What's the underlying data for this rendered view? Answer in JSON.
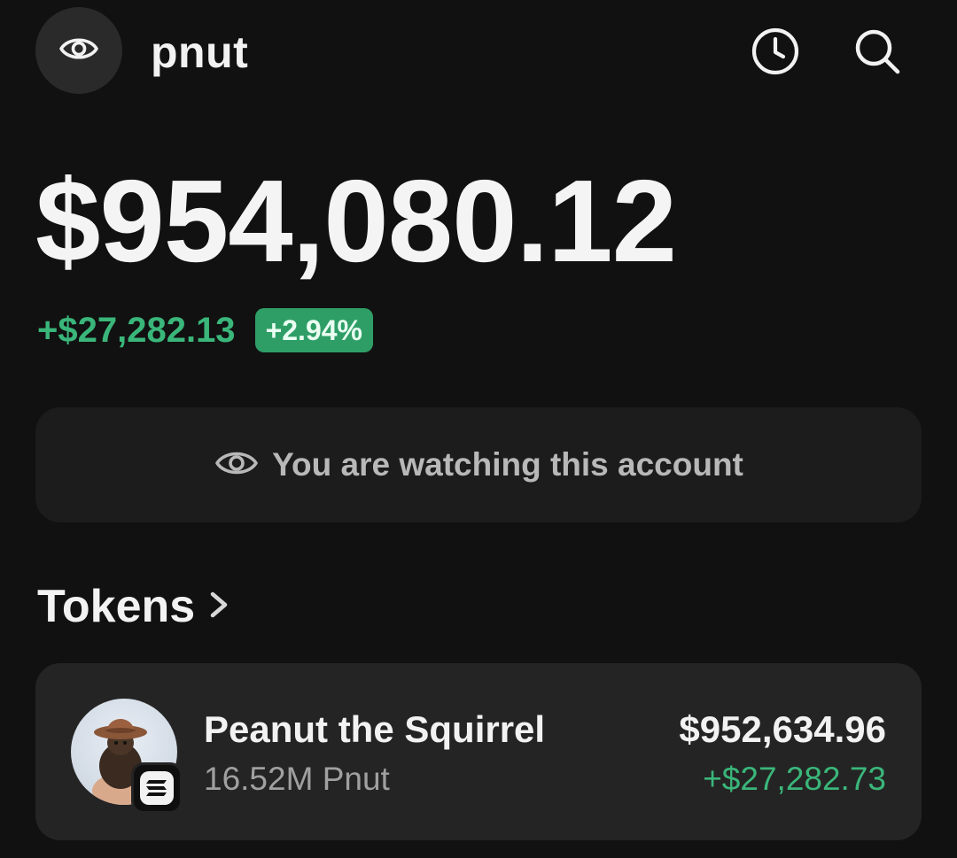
{
  "header": {
    "account_name": "pnut",
    "watch_icon": "eye-icon",
    "history_icon": "clock-icon",
    "search_icon": "search-icon"
  },
  "balance": {
    "total": "$954,080.12",
    "change_amount": "+$27,282.13",
    "change_percent": "+2.94%"
  },
  "banner": {
    "icon": "eye-icon",
    "text": "You are watching this account"
  },
  "tokens": {
    "title": "Tokens",
    "items": [
      {
        "name": "Peanut the Squirrel",
        "quantity": "16.52M Pnut",
        "value": "$952,634.96",
        "change": "+$27,282.73",
        "chain_icon": "solana-icon"
      }
    ]
  },
  "colors": {
    "background": "#111111",
    "card": "#242424",
    "positive": "#3ab67a",
    "badge": "#2e9e66"
  }
}
